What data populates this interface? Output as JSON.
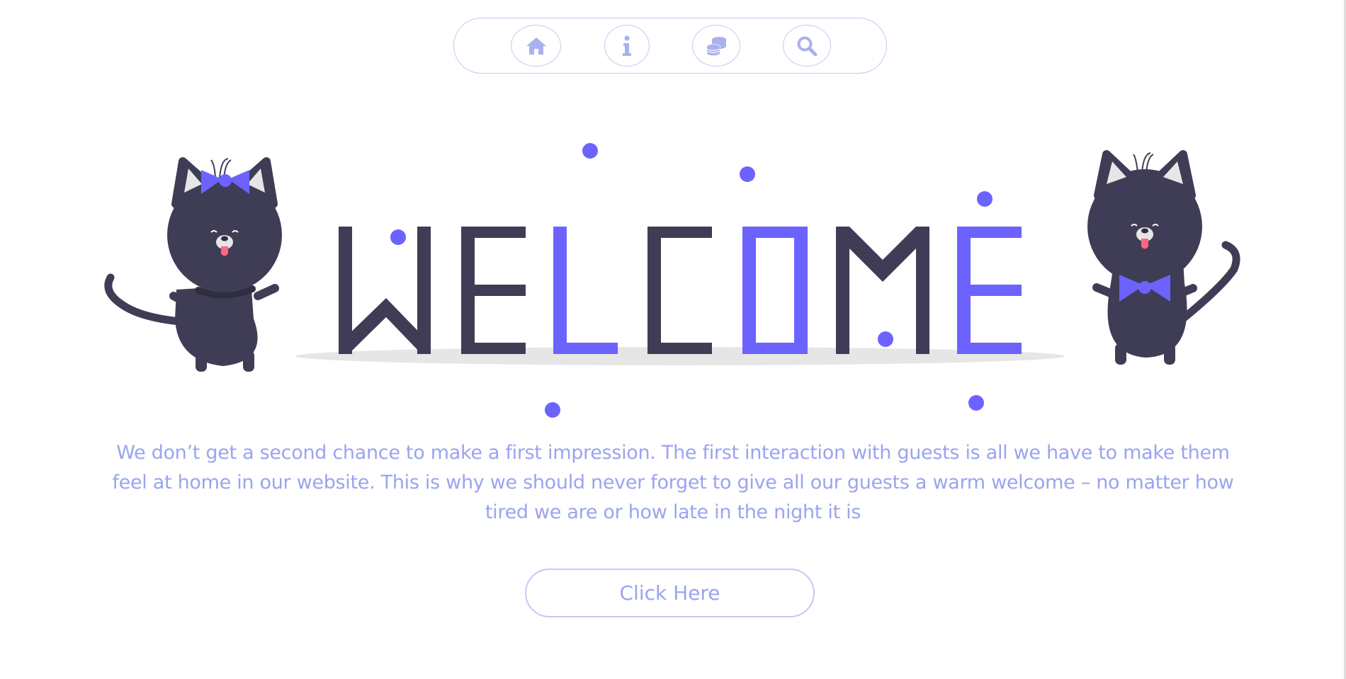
{
  "nav": {
    "items": [
      {
        "icon": "home-icon"
      },
      {
        "icon": "info-icon"
      },
      {
        "icon": "coins-icon"
      },
      {
        "icon": "search-icon"
      }
    ]
  },
  "hero": {
    "heading": "WELCOME",
    "illustration": "two cartoon cats with bows beside welcome lettering"
  },
  "main": {
    "tagline": "We don’t get a second chance to make a first impression. The first interaction with guests is all we have to make them feel at home in our website. This is why we should never forget to give all our guests a warm welcome – no matter how tired we are or how late in the night it is",
    "cta_label": "Click Here"
  },
  "colors": {
    "accent": "#6c63ff",
    "dark": "#3f3d56",
    "soft_blue": "#9aa4ef",
    "border": "#c3c9f3",
    "tongue": "#ff6584",
    "shadow": "#e6e6e6"
  }
}
